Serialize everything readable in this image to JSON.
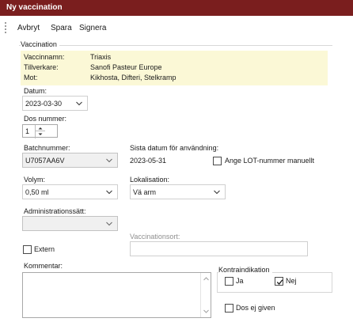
{
  "window": {
    "title": "Ny vaccination"
  },
  "menu": {
    "items": [
      "Avbryt",
      "Spara",
      "Signera"
    ]
  },
  "vaccination": {
    "group_title": "Vaccination",
    "info": [
      {
        "label": "Vaccinnamn:",
        "value": "Triaxis"
      },
      {
        "label": "Tillverkare:",
        "value": "Sanofi Pasteur Europe"
      },
      {
        "label": "Mot:",
        "value": "Kikhosta, Difteri, Stelkramp"
      }
    ],
    "info_bg": "#fbf8d6",
    "datum": {
      "label": "Datum:",
      "value": "2023-03-30"
    },
    "dos": {
      "label": "Dos nummer:",
      "value": "1"
    },
    "batch": {
      "label": "Batchnummer:",
      "value": "U7057AA6V"
    },
    "sista": {
      "label": "Sista datum för användning:",
      "value": "2023-05-31"
    },
    "lot_manual": {
      "label": "Ange LOT-nummer manuellt",
      "checked": false
    },
    "volym": {
      "label": "Volym:",
      "value": "0,50 ml"
    },
    "lokalisation": {
      "label": "Lokalisation:",
      "value": "Vä arm"
    },
    "administrationssatt": {
      "label": "Administrationssätt:",
      "value": ""
    },
    "vaccinationsort": {
      "label": "Vaccinationsort:",
      "value": ""
    },
    "extern": {
      "label": "Extern",
      "checked": false
    },
    "kommentar": {
      "label": "Kommentar:",
      "value": ""
    },
    "kontraindikation": {
      "title": "Kontraindikation",
      "ja": {
        "label": "Ja",
        "checked": false
      },
      "nej": {
        "label": "Nej",
        "checked": true
      }
    },
    "dos_ej_given": {
      "label": "Dos ej given",
      "checked": false
    }
  },
  "colors": {
    "titlebar": "#7a1e1e",
    "accent": "#7a1e1e"
  }
}
